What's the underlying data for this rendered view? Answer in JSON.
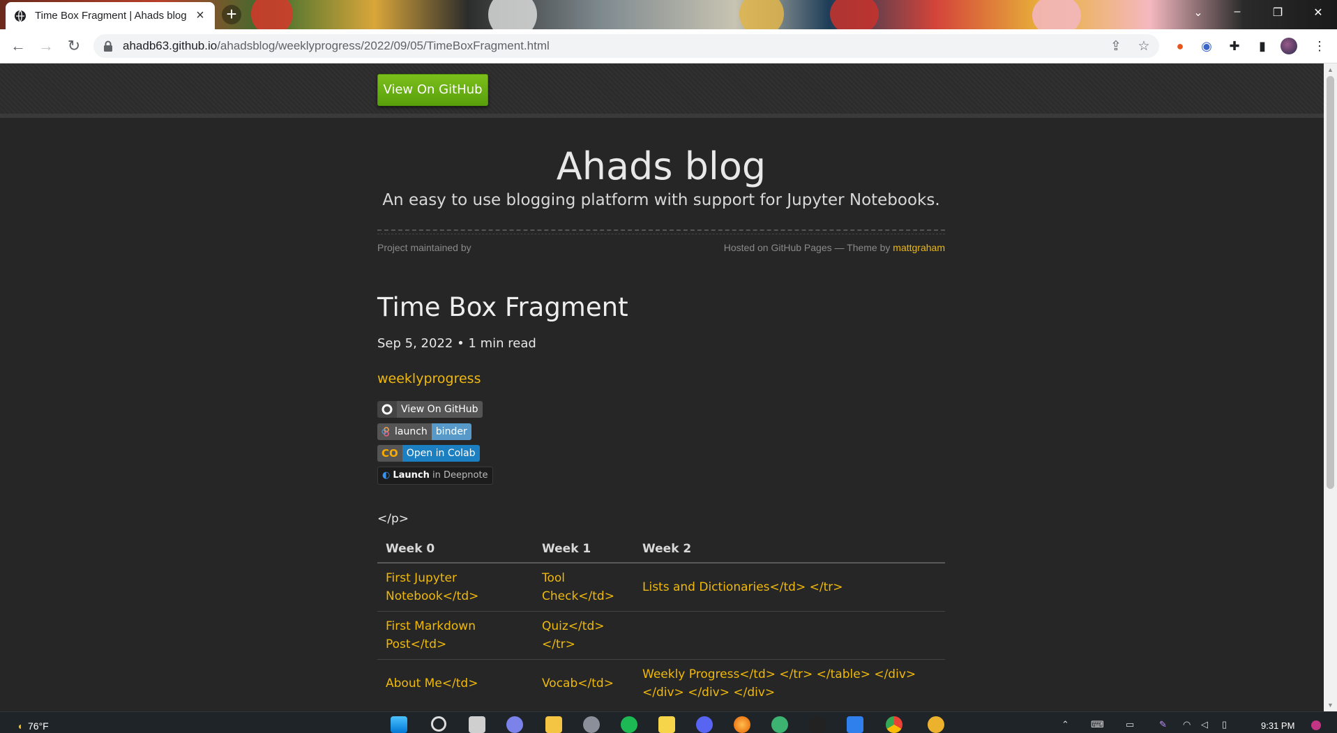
{
  "browser": {
    "tab_title": "Time Box Fragment | Ahads blog",
    "url_host": "ahadb63.github.io",
    "url_path": "/ahadsblog/weeklyprogress/2022/09/05/TimeBoxFragment.html"
  },
  "header": {
    "github_button": "View On GitHub"
  },
  "site": {
    "title": "Ahads blog",
    "subtitle": "An easy to use blogging platform with support for Jupyter Notebooks.",
    "maintained": "Project maintained by",
    "hosted": "Hosted on GitHub Pages — Theme by",
    "theme_author": "mattgraham"
  },
  "post": {
    "title": "Time Box Fragment",
    "meta": "Sep 5, 2022 • 1 min read",
    "category": "weeklyprogress",
    "stray_tag": "</p>"
  },
  "badges": {
    "github": "View On GitHub",
    "binder_left": "launch",
    "binder_right": "binder",
    "colab": "Open in Colab",
    "deepnote_bold": "Launch",
    "deepnote_rest": "in Deepnote"
  },
  "table": {
    "headers": [
      "Week 0",
      "Week 1",
      "Week 2"
    ],
    "rows": [
      [
        "First Jupyter Notebook</td>",
        "Tool Check</td>",
        "Lists and Dictionaries</td> </tr>"
      ],
      [
        "First Markdown Post</td>",
        "Quiz</td> </tr>",
        ""
      ],
      [
        "About Me</td>",
        "Vocab</td>",
        "Weekly Progress</td> </tr> </table> </div> </div> </div> </div>"
      ]
    ]
  },
  "taskbar": {
    "weather": "76°F",
    "time": "9:31 PM"
  },
  "colors": {
    "accent": "#f0b90b",
    "github_green": "#69b313",
    "binder_blue": "#579aca",
    "colab_blue": "#1b7fc1"
  }
}
